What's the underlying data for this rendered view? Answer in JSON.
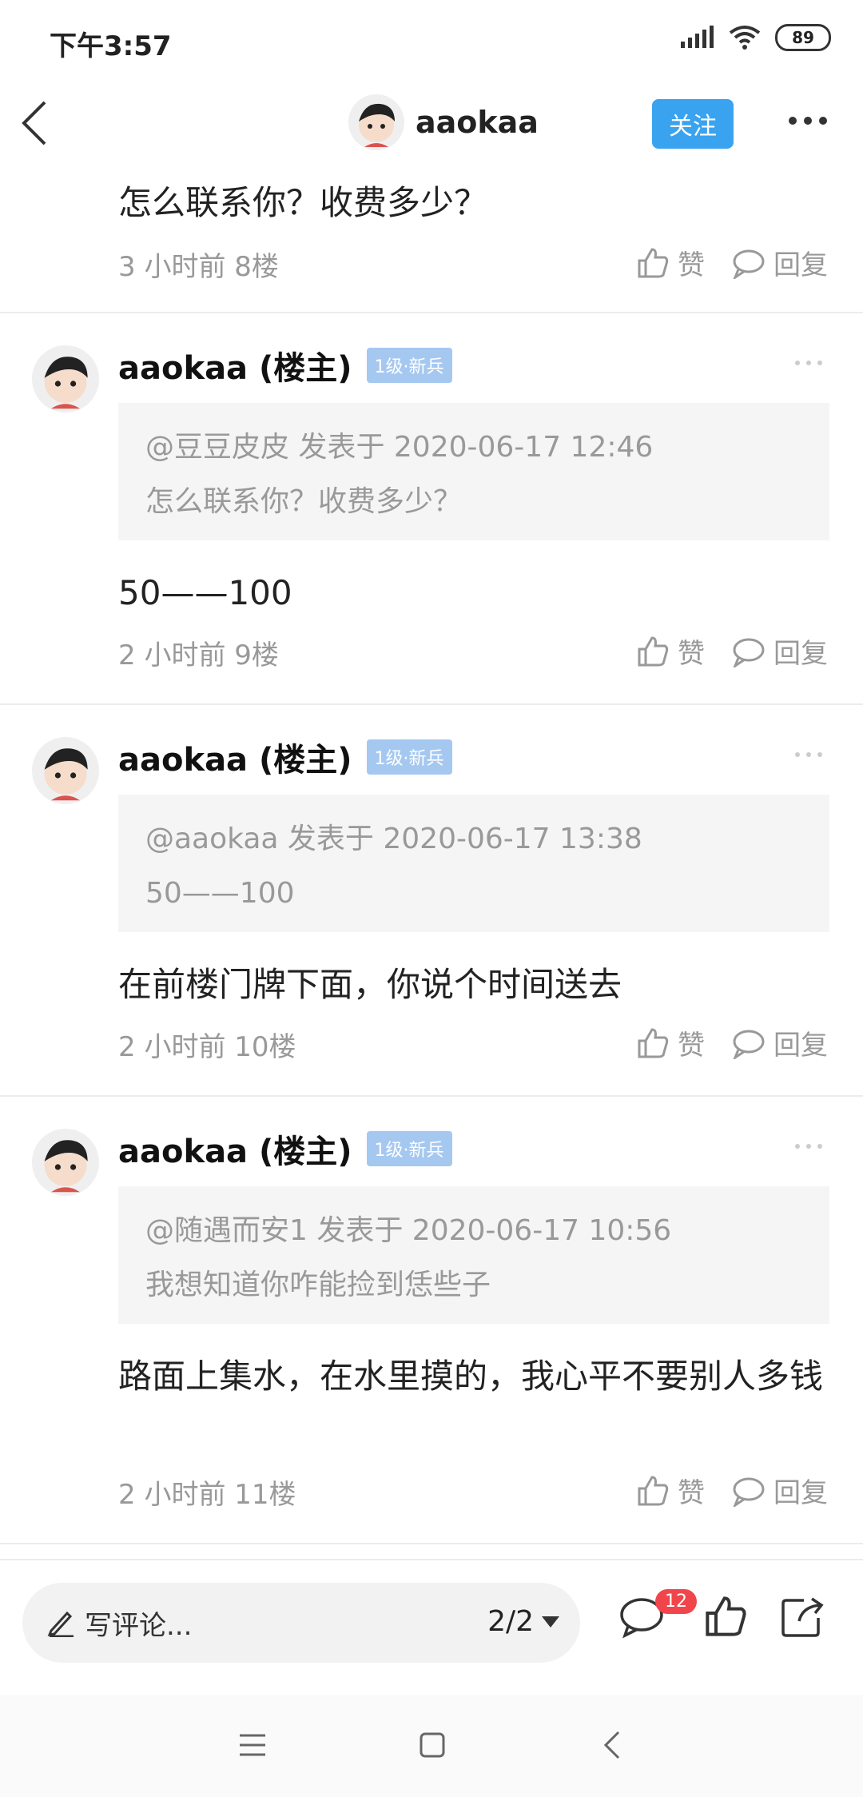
{
  "status": {
    "time": "下午3:57",
    "battery": "89"
  },
  "nav": {
    "username": "aaokaa",
    "follow_label": "关注"
  },
  "top_comment": {
    "text": "怎么联系你？收费多少？",
    "meta": "3 小时前  8楼"
  },
  "actions": {
    "like": "赞",
    "reply": "回复"
  },
  "comments": [
    {
      "name": "aaokaa (楼主)",
      "badge": "1级·新兵",
      "quote_author": "@豆豆皮皮 发表于 2020-06-17 12:46",
      "quote_text": "怎么联系你？收费多少？",
      "text": "50——100",
      "meta": "2 小时前  9楼"
    },
    {
      "name": "aaokaa (楼主)",
      "badge": "1级·新兵",
      "quote_author": "@aaokaa 发表于 2020-06-17 13:38",
      "quote_text": "50——100",
      "text": "在前楼门牌下面，你说个时间送去",
      "meta": "2 小时前  10楼"
    },
    {
      "name": "aaokaa (楼主)",
      "badge": "1级·新兵",
      "quote_author": "@随遇而安1 发表于 2020-06-17 10:56",
      "quote_text": "我想知道你咋能捡到恁些子",
      "text": "路面上集水，在水里摸的，我心平不要别人多钱",
      "meta": "2 小时前  11楼"
    }
  ],
  "bottom": {
    "write_placeholder": "写评论...",
    "page": "2/2",
    "comment_count": "12"
  },
  "colors": {
    "accent": "#39a3f0",
    "badge": "#a5c8f1",
    "notify": "#f0464b"
  }
}
